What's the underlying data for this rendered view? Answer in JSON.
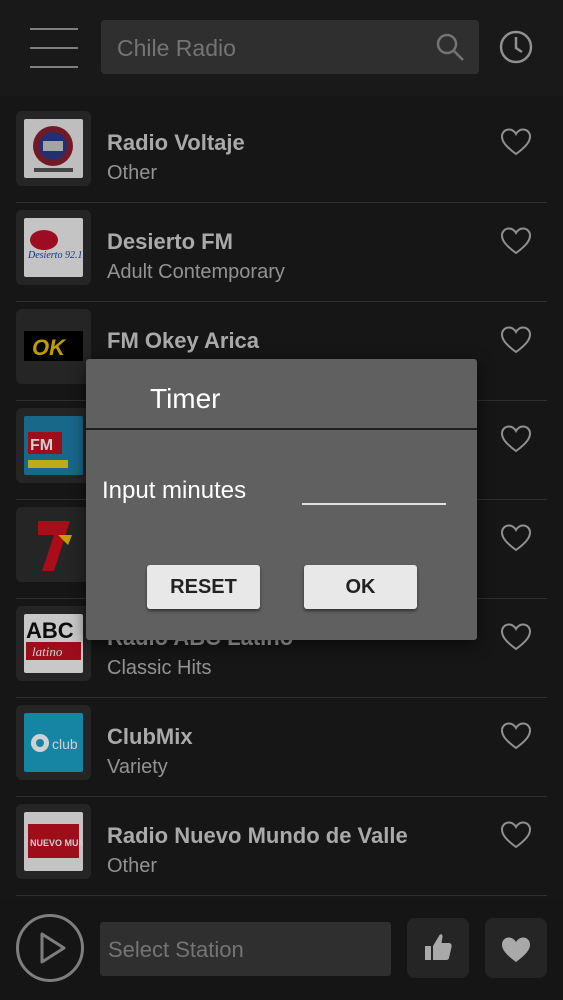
{
  "header": {
    "search_placeholder": "Chile Radio"
  },
  "stations": [
    {
      "name": "Radio Voltaje",
      "genre": "Other"
    },
    {
      "name": "Desierto FM",
      "genre": "Adult Contemporary"
    },
    {
      "name": "FM Okey Arica",
      "genre": ""
    },
    {
      "name": "",
      "genre": ""
    },
    {
      "name": "",
      "genre": ""
    },
    {
      "name": "Radio ABC Latino",
      "genre": "Classic Hits"
    },
    {
      "name": "ClubMix",
      "genre": "Variety"
    },
    {
      "name": "Radio Nuevo Mundo de Valle",
      "genre": "Other"
    }
  ],
  "player": {
    "select_placeholder": "Select Station"
  },
  "dialog": {
    "title": "Timer",
    "input_label": "Input minutes",
    "input_value": "",
    "reset_label": "RESET",
    "ok_label": "OK"
  },
  "logos": {
    "voltaje": "",
    "desierto": "Desierto 92.1",
    "okey": "OK",
    "fm4": "FM",
    "abc": "ABC",
    "abc_sub": "latino",
    "clubmix": "club",
    "nuevo": "NUEVO MUNDO"
  },
  "colors": {
    "background": "#1c1c1c",
    "dialog": "#606060",
    "button": "#e8e8e8"
  }
}
